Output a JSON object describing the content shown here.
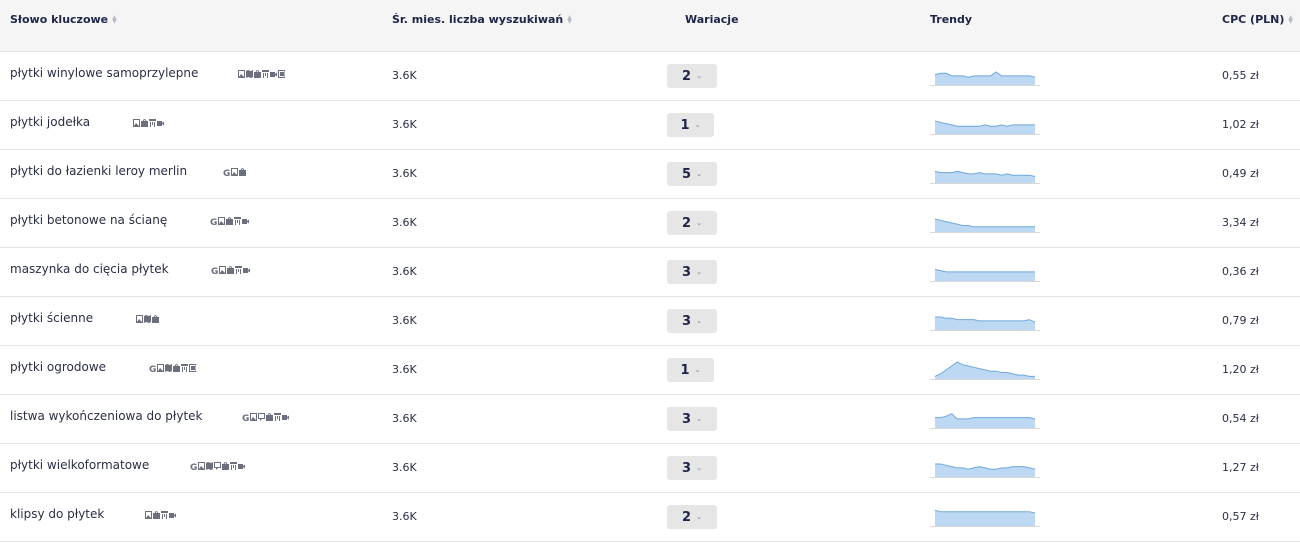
{
  "header": {
    "keyword": "Słowo kluczowe",
    "volume": "Śr. mies. liczba wyszukiwań",
    "variations": "Wariacje",
    "trends": "Trendy",
    "cpc": "CPC (PLN)"
  },
  "colors": {
    "trend_fill": "#bcd8f2",
    "trend_line": "#6fa8dc",
    "variation_bg": "#e6e6e6"
  },
  "rows": [
    {
      "keyword": "płytki winylowe samoprzylepne",
      "volume": "3.6K",
      "variations": "2",
      "cpc": "0,55 zł",
      "serp_features": [
        "image-icon",
        "map-icon",
        "shopping-icon",
        "sitelinks-icon",
        "video-icon",
        "knowledge-panel-icon"
      ],
      "trend": [
        8,
        9,
        9,
        7,
        7,
        7,
        6,
        7,
        7,
        7,
        7,
        10,
        7,
        7,
        7,
        7,
        7,
        7,
        6
      ]
    },
    {
      "keyword": "płytki jodełka",
      "volume": "3.6K",
      "variations": "1",
      "cpc": "1,02 zł",
      "serp_features": [
        "image-icon",
        "shopping-icon",
        "sitelinks-icon",
        "video-icon"
      ],
      "trend": [
        10,
        9,
        8,
        7,
        6,
        6,
        6,
        6,
        6,
        7,
        6,
        6,
        7,
        6,
        7,
        7,
        7,
        7,
        7
      ]
    },
    {
      "keyword": "płytki do łazienki leroy merlin",
      "volume": "3.6K",
      "variations": "5",
      "cpc": "0,49 zł",
      "serp_features": [
        "google-icon",
        "image-icon",
        "shopping-icon"
      ],
      "trend": [
        9,
        8,
        8,
        8,
        9,
        8,
        7,
        7,
        8,
        7,
        7,
        7,
        6,
        7,
        6,
        6,
        6,
        6,
        5
      ]
    },
    {
      "keyword": "płytki betonowe na ścianę",
      "volume": "3.6K",
      "variations": "2",
      "cpc": "3,34 zł",
      "serp_features": [
        "google-icon",
        "image-icon",
        "shopping-icon",
        "sitelinks-icon",
        "video-icon"
      ],
      "trend": [
        10,
        9,
        8,
        7,
        6,
        5,
        5,
        4,
        4,
        4,
        4,
        4,
        4,
        4,
        4,
        4,
        4,
        4,
        4
      ]
    },
    {
      "keyword": "maszynka do cięcia płytek",
      "volume": "3.6K",
      "variations": "3",
      "cpc": "0,36 zł",
      "serp_features": [
        "google-icon",
        "image-icon",
        "shopping-icon",
        "sitelinks-icon",
        "video-icon"
      ],
      "trend": [
        9,
        8,
        7,
        7,
        7,
        7,
        7,
        7,
        7,
        7,
        7,
        7,
        7,
        7,
        7,
        7,
        7,
        7,
        7
      ]
    },
    {
      "keyword": "płytki ścienne",
      "volume": "3.6K",
      "variations": "3",
      "cpc": "0,79 zł",
      "serp_features": [
        "image-icon",
        "map-icon",
        "shopping-icon"
      ],
      "trend": [
        10,
        10,
        9,
        9,
        8,
        8,
        8,
        8,
        7,
        7,
        7,
        7,
        7,
        7,
        7,
        7,
        7,
        8,
        6
      ]
    },
    {
      "keyword": "płytki ogrodowe",
      "volume": "3.6K",
      "variations": "1",
      "cpc": "1,20 zł",
      "serp_features": [
        "google-icon",
        "image-icon",
        "map-icon",
        "shopping-icon",
        "sitelinks-icon",
        "knowledge-panel-icon"
      ],
      "trend": [
        2,
        4,
        7,
        10,
        13,
        11,
        10,
        9,
        8,
        7,
        6,
        6,
        5,
        5,
        4,
        3,
        3,
        2,
        2
      ]
    },
    {
      "keyword": "listwa wykończeniowa do płytek",
      "volume": "3.6K",
      "variations": "3",
      "cpc": "0,54 zł",
      "serp_features": [
        "google-icon",
        "image-icon",
        "reviews-icon",
        "shopping-icon",
        "sitelinks-icon",
        "video-icon"
      ],
      "trend": [
        8,
        8,
        9,
        11,
        7,
        7,
        7,
        8,
        8,
        8,
        8,
        8,
        8,
        8,
        8,
        8,
        8,
        8,
        7
      ]
    },
    {
      "keyword": "płytki wielkoformatowe",
      "volume": "3.6K",
      "variations": "3",
      "cpc": "1,27 zł",
      "serp_features": [
        "google-icon",
        "image-icon",
        "map-icon",
        "reviews-icon",
        "shopping-icon",
        "sitelinks-icon",
        "video-icon"
      ],
      "trend": [
        10,
        10,
        9,
        8,
        7,
        7,
        6,
        7,
        8,
        7,
        6,
        6,
        7,
        7,
        8,
        8,
        8,
        7,
        6
      ]
    },
    {
      "keyword": "klipsy do płytek",
      "volume": "3.6K",
      "variations": "2",
      "cpc": "0,57 zł",
      "serp_features": [
        "image-icon",
        "shopping-icon",
        "sitelinks-icon",
        "video-icon"
      ],
      "trend": [
        12,
        11,
        11,
        11,
        11,
        11,
        11,
        11,
        11,
        11,
        11,
        11,
        11,
        11,
        11,
        11,
        11,
        11,
        10
      ]
    }
  ]
}
